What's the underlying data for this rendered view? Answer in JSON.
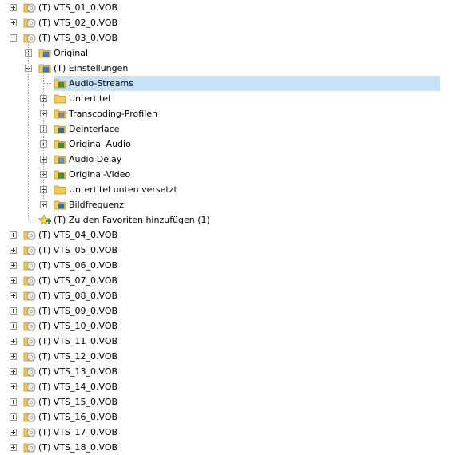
{
  "tree": {
    "top": [
      {
        "label": "(T) VTS_01_0.VOB",
        "expanded": false
      },
      {
        "label": "(T) VTS_02_0.VOB",
        "expanded": false
      },
      {
        "label": "(T) VTS_03_0.VOB",
        "expanded": true,
        "children": [
          {
            "label": "Original",
            "expanded": false,
            "icon": "folder-media-icon"
          },
          {
            "label": "(T) Einstellungen",
            "expanded": true,
            "icon": "folder-settings-icon",
            "children": [
              {
                "label": "Audio-Streams",
                "icon": "folder-audio-icon",
                "selected": true,
                "hasChildren": false
              },
              {
                "label": "Untertitel",
                "icon": "folder-subtitle-icon",
                "hasChildren": true
              },
              {
                "label": "Transcoding-Profilen",
                "icon": "folder-transcode-icon",
                "hasChildren": true
              },
              {
                "label": "Deinterlace",
                "icon": "folder-deinterlace-icon",
                "hasChildren": true
              },
              {
                "label": "Original Audio",
                "icon": "folder-audio-icon",
                "hasChildren": true
              },
              {
                "label": "Audio Delay",
                "icon": "folder-delay-icon",
                "hasChildren": true
              },
              {
                "label": "Original-Video",
                "icon": "folder-video-icon",
                "hasChildren": true
              },
              {
                "label": "Untertitel unten versetzt",
                "icon": "folder-subtitle-icon",
                "hasChildren": true
              },
              {
                "label": "Bildfrequenz",
                "icon": "folder-framerate-icon",
                "hasChildren": true
              }
            ]
          },
          {
            "label": "(T) Zu den Favoriten hinzufügen (1)",
            "icon": "favorite-add-icon",
            "hasChildren": false
          }
        ]
      },
      {
        "label": "(T) VTS_04_0.VOB",
        "expanded": false
      },
      {
        "label": "(T) VTS_05_0.VOB",
        "expanded": false
      },
      {
        "label": "(T) VTS_06_0.VOB",
        "expanded": false
      },
      {
        "label": "(T) VTS_07_0.VOB",
        "expanded": false
      },
      {
        "label": "(T) VTS_08_0.VOB",
        "expanded": false
      },
      {
        "label": "(T) VTS_09_0.VOB",
        "expanded": false
      },
      {
        "label": "(T) VTS_10_0.VOB",
        "expanded": false
      },
      {
        "label": "(T) VTS_11_0.VOB",
        "expanded": false
      },
      {
        "label": "(T) VTS_12_0.VOB",
        "expanded": false
      },
      {
        "label": "(T) VTS_13_0.VOB",
        "expanded": false
      },
      {
        "label": "(T) VTS_14_0.VOB",
        "expanded": false
      },
      {
        "label": "(T) VTS_15_0.VOB",
        "expanded": false
      },
      {
        "label": "(T) VTS_16_0.VOB",
        "expanded": false
      },
      {
        "label": "(T) VTS_17_0.VOB",
        "expanded": false
      },
      {
        "label": "(T) VTS_18_0.VOB",
        "expanded": false
      }
    ],
    "colors": {
      "selection": "#c7e1f8",
      "folder": "#f1c84b",
      "disc": "#d9d9d9"
    }
  }
}
